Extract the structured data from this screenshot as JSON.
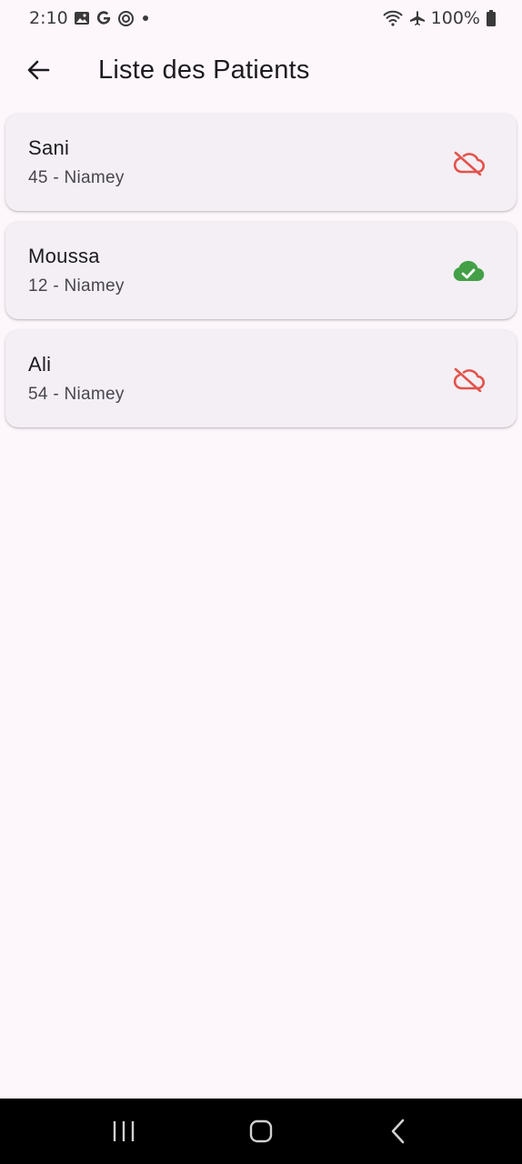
{
  "status_bar": {
    "time": "2:10",
    "battery": "100%",
    "left_icons": [
      "image-icon",
      "google-icon",
      "target-icon",
      "dot-icon"
    ],
    "right_icons": [
      "wifi-icon",
      "airplane-icon",
      "battery-icon"
    ]
  },
  "app_bar": {
    "title": "Liste des Patients",
    "back_icon": "arrow-left-icon"
  },
  "patients": [
    {
      "name": "Sani",
      "info": "45 - Niamey",
      "sync_status": "cloud-off-icon",
      "status_color": "#e2534c"
    },
    {
      "name": "Moussa",
      "info": "12 - Niamey",
      "sync_status": "cloud-done-icon",
      "status_color": "#43a047"
    },
    {
      "name": "Ali",
      "info": "54 - Niamey",
      "sync_status": "cloud-off-icon",
      "status_color": "#e2534c"
    }
  ],
  "nav_bar": {
    "buttons": [
      "recent-apps-icon",
      "home-icon",
      "back-icon"
    ]
  },
  "colors": {
    "background": "#fdf7fc",
    "card": "#f3eff4",
    "error": "#e2534c",
    "success": "#43a047"
  }
}
